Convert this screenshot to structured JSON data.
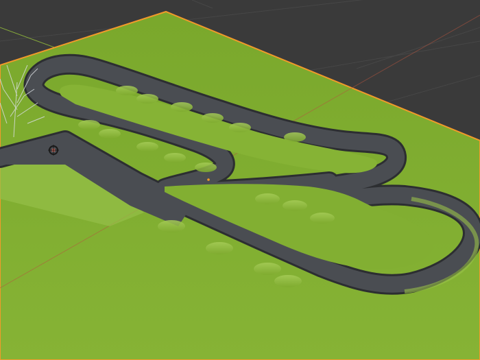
{
  "viewport": {
    "background_color": "#3a3a3a",
    "grid_line_color": "#474747",
    "ground_color": "#7fab2f",
    "ground_outline_color": "#f29a2a",
    "track_color": "#4a4d52",
    "track_edge_color": "#2c2e31",
    "mound_color": "#9ac24a",
    "axis_x_color": "#b5553f",
    "axis_y_color": "#86a93a",
    "light_icon": "light-object-icon",
    "tree_icon": "bare-tree-icon"
  }
}
